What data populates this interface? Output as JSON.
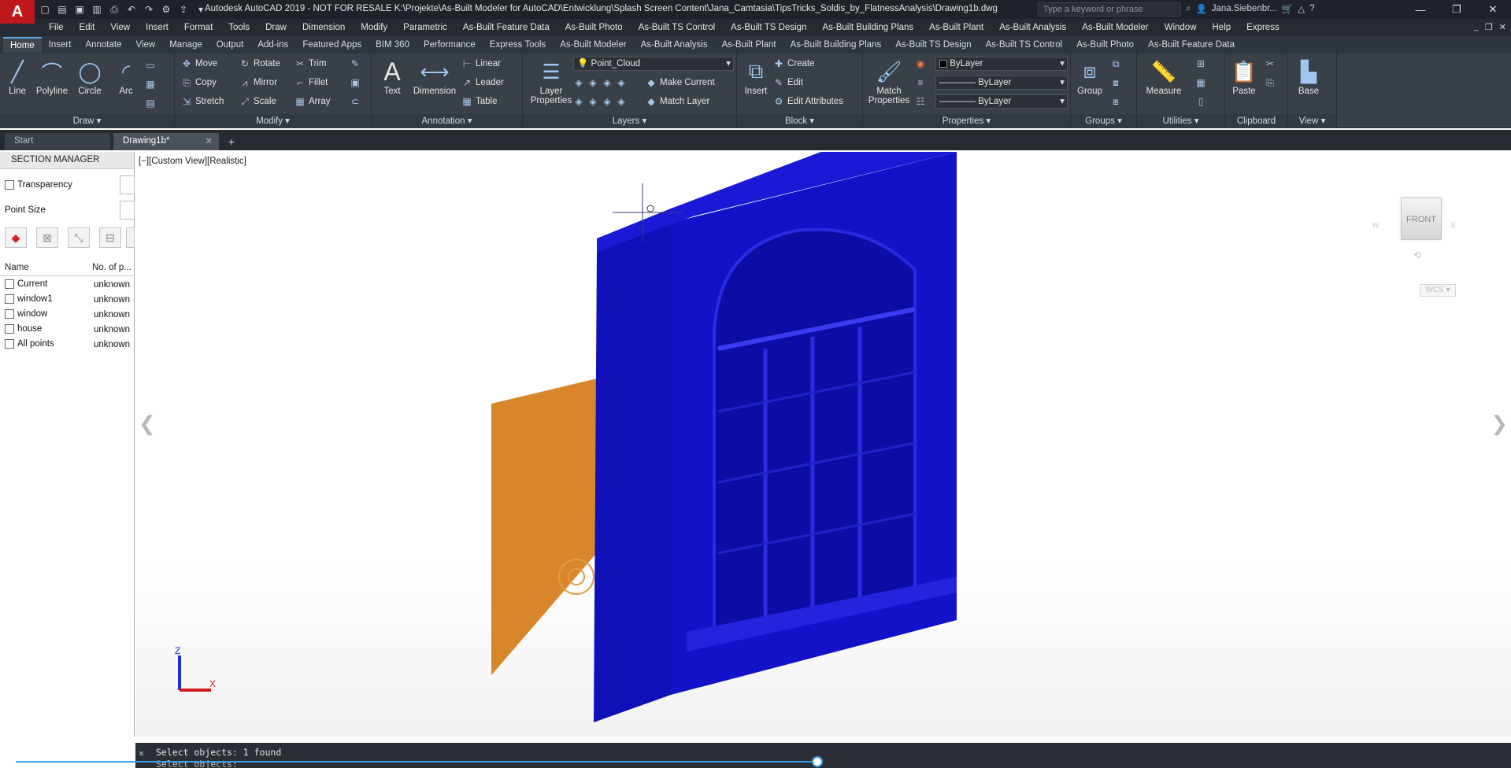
{
  "titlebar": {
    "app_logo": "A",
    "title": "Autodesk AutoCAD 2019 - NOT FOR RESALE    K:\\Projekte\\As-Built Modeler for AutoCAD\\Entwicklung\\Splash Screen Content\\Jana_Camtasia\\TipsTricks_Soldis_by_FlatnessAnalysis\\Drawing1b.dwg",
    "search_placeholder": "Type a keyword or phrase",
    "user": "Jana.Siebenbr...",
    "controls": [
      "—",
      "❐",
      "✕"
    ]
  },
  "menubar": {
    "items": [
      "File",
      "Edit",
      "View",
      "Insert",
      "Format",
      "Tools",
      "Draw",
      "Dimension",
      "Modify",
      "Parametric",
      "As-Built Feature Data",
      "As-Built Photo",
      "As-Built TS Control",
      "As-Built TS Design",
      "As-Built Building Plans",
      "As-Built Plant",
      "As-Built Analysis",
      "As-Built Modeler",
      "Window",
      "Help",
      "Express"
    ]
  },
  "ribbon_tabs": {
    "items": [
      "Home",
      "Insert",
      "Annotate",
      "View",
      "Manage",
      "Output",
      "Add-ins",
      "Featured Apps",
      "BIM 360",
      "Performance",
      "Express Tools",
      "As-Built Modeler",
      "As-Built Analysis",
      "As-Built Plant",
      "As-Built Building Plans",
      "As-Built TS Design",
      "As-Built TS Control",
      "As-Built Photo",
      "As-Built Feature Data"
    ],
    "active": "Home"
  },
  "ribbon": {
    "draw": {
      "footer": "Draw ▾",
      "line": "Line",
      "polyline": "Polyline",
      "circle": "Circle",
      "arc": "Arc"
    },
    "modify": {
      "footer": "Modify ▾",
      "move": "Move",
      "rotate": "Rotate",
      "trim": "Trim",
      "copy": "Copy",
      "mirror": "Mirror",
      "fillet": "Fillet",
      "stretch": "Stretch",
      "scale": "Scale",
      "array": "Array"
    },
    "annotation": {
      "footer": "Annotation ▾",
      "text": "Text",
      "dimension": "Dimension",
      "linear": "Linear",
      "leader": "Leader",
      "table": "Table"
    },
    "layers": {
      "footer": "Layers ▾",
      "layer_properties": "Layer Properties",
      "current_layer": "Point_Cloud",
      "make_current": "Make Current",
      "match_layer": "Match Layer"
    },
    "block": {
      "footer": "Block ▾",
      "insert": "Insert",
      "create": "Create",
      "edit": "Edit",
      "edit_attributes": "Edit Attributes"
    },
    "properties": {
      "footer": "Properties ▾",
      "match_properties": "Match Properties",
      "color": "ByLayer",
      "linetype": "ByLayer",
      "lineweight": "ByLayer"
    },
    "groups": {
      "footer": "Groups ▾",
      "group": "Group"
    },
    "utilities": {
      "footer": "Utilities ▾",
      "measure": "Measure"
    },
    "clipboard": {
      "footer": "Clipboard",
      "paste": "Paste"
    },
    "view": {
      "footer": "View ▾",
      "base": "Base"
    }
  },
  "file_tabs": {
    "items": [
      {
        "label": "Start",
        "active": false
      },
      {
        "label": "Drawing1b*",
        "active": true
      }
    ]
  },
  "section_manager": {
    "title": "SECTION MANAGER",
    "transparency_label": "Transparency",
    "point_size_label": "Point Size",
    "columns": [
      "Name",
      "No. of p..."
    ],
    "rows": [
      {
        "name": "Current",
        "count": "unknown"
      },
      {
        "name": "window1",
        "count": "unknown"
      },
      {
        "name": "window",
        "count": "unknown"
      },
      {
        "name": "house",
        "count": "unknown"
      },
      {
        "name": "All points",
        "count": "unknown"
      }
    ]
  },
  "viewport": {
    "label": "[−][Custom View][Realistic]",
    "viewcube_face": "FRONT",
    "wcs": "WCS ▾",
    "ucs_x": "X",
    "ucs_z": "Z"
  },
  "command_line": {
    "line1": "Select objects: 1 found",
    "line2": "Select objects:"
  },
  "colors": {
    "model_blue": "#1212c8",
    "plane_orange": "#d6801e",
    "title_bg": "#1f2329",
    "ribbon_bg": "#3a4047"
  }
}
